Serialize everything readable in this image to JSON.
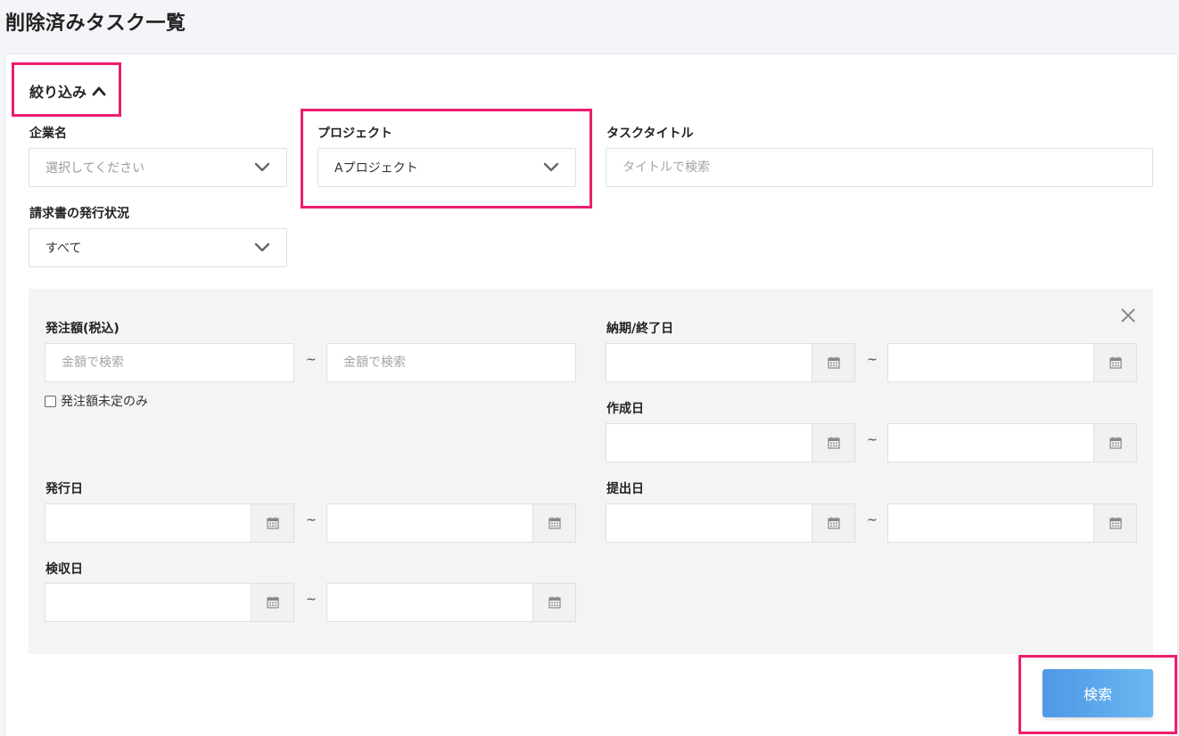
{
  "page": {
    "title": "削除済みタスク一覧"
  },
  "filter": {
    "toggle_label": "絞り込み",
    "company": {
      "label": "企業名",
      "value": "選択してください"
    },
    "project": {
      "label": "プロジェクト",
      "value": "Aプロジェクト"
    },
    "task_title": {
      "label": "タスクタイトル",
      "placeholder": "タイトルで検索"
    },
    "invoice_status": {
      "label": "請求書の発行状況",
      "value": "すべて"
    }
  },
  "detail": {
    "amount": {
      "label": "発注額(税込)",
      "from_placeholder": "金額で検索",
      "to_placeholder": "金額で検索",
      "separator": "~",
      "checkbox_label": "発注額未定のみ",
      "checkbox_checked": false
    },
    "issue_date": {
      "label": "発行日",
      "separator": "~"
    },
    "inspection_date": {
      "label": "検収日",
      "separator": "~"
    },
    "due_date": {
      "label": "納期/終了日",
      "separator": "~"
    },
    "created_date": {
      "label": "作成日",
      "separator": "~"
    },
    "submitted_date": {
      "label": "提出日",
      "separator": "~"
    }
  },
  "actions": {
    "search_label": "検索"
  },
  "colors": {
    "highlight": "#ec1d6e",
    "button_start": "#4f97e6",
    "button_end": "#6ab8f0",
    "panel_bg": "#f4f4f4"
  },
  "icons": [
    "chevron-up-icon",
    "chevron-down-icon",
    "calendar-icon",
    "close-icon"
  ]
}
